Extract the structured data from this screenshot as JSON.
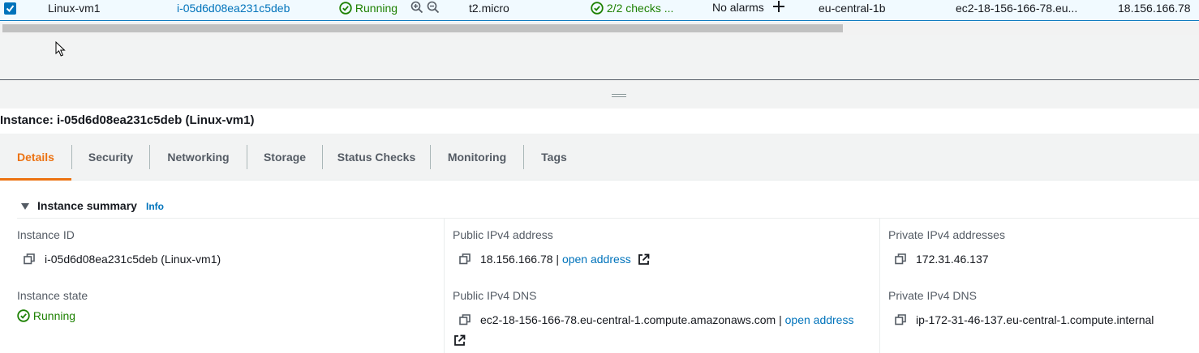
{
  "table_row": {
    "checked": true,
    "name": "Linux-vm1",
    "instance_id": "i-05d6d08ea231c5deb",
    "state": "Running",
    "instance_type": "t2.micro",
    "status_check": "2/2 checks ...",
    "alarm_status": "No alarms",
    "availability_zone": "eu-central-1b",
    "public_dns": "ec2-18-156-166-78.eu...",
    "public_ip": "18.156.166.78"
  },
  "instance_header": "Instance: i-05d6d08ea231c5deb (Linux-vm1)",
  "tabs": [
    {
      "label": "Details",
      "active": true
    },
    {
      "label": "Security"
    },
    {
      "label": "Networking"
    },
    {
      "label": "Storage"
    },
    {
      "label": "Status Checks"
    },
    {
      "label": "Monitoring"
    },
    {
      "label": "Tags"
    }
  ],
  "summary": {
    "title": "Instance summary",
    "info": "Info",
    "instance_id_label": "Instance ID",
    "instance_id_value": "i-05d6d08ea231c5deb (Linux-vm1)",
    "instance_state_label": "Instance state",
    "instance_state_value": "Running",
    "public_ipv4_label": "Public IPv4 address",
    "public_ipv4_value": "18.156.166.78",
    "separator": "|",
    "open_address": "open address",
    "public_dns_label": "Public IPv4 DNS",
    "public_dns_value": "ec2-18-156-166-78.eu-central-1.compute.amazonaws.com",
    "private_ipv4_label": "Private IPv4 addresses",
    "private_ipv4_value": "172.31.46.137",
    "private_dns_label": "Private IPv4 DNS",
    "private_dns_value": "ip-172-31-46-137.eu-central-1.compute.internal"
  },
  "colors": {
    "link": "#0073bb",
    "success": "#1d8102",
    "active_tab": "#ec7211"
  }
}
